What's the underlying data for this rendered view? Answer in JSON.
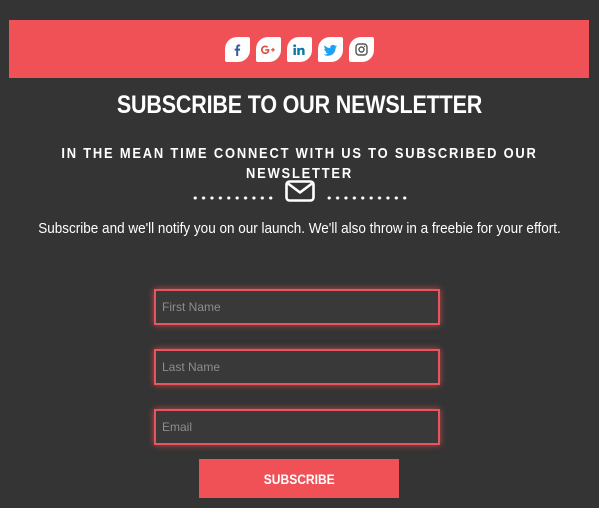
{
  "social": [
    {
      "icon": "facebook-icon",
      "name": "facebook",
      "color": "#3b5998"
    },
    {
      "icon": "google-plus-icon",
      "name": "google-plus",
      "color": "#dd4b39"
    },
    {
      "icon": "linkedin-icon",
      "name": "linkedin",
      "color": "#0e76a8"
    },
    {
      "icon": "twitter-icon",
      "name": "twitter",
      "color": "#1da1f2"
    },
    {
      "icon": "instagram-icon",
      "name": "instagram",
      "color": "#555555"
    }
  ],
  "header": {
    "title": "SUBSCRIBE TO OUR NEWSLETTER",
    "subtitle": "IN THE MEAN TIME CONNECT WITH US TO SUBSCRIBED OUR NEWSLETTER",
    "divider_icon": "envelope-icon",
    "description": "Subscribe and we'll notify you on our launch. We'll also throw in a freebie for your effort."
  },
  "form": {
    "first_name": {
      "value": "",
      "placeholder": "First Name"
    },
    "last_name": {
      "value": "",
      "placeholder": "Last Name"
    },
    "email": {
      "value": "",
      "placeholder": "Email"
    },
    "submit_label": "SUBSCRIBE"
  },
  "colors": {
    "accent": "#ef5157",
    "background": "#343434",
    "text": "#ffffff"
  }
}
